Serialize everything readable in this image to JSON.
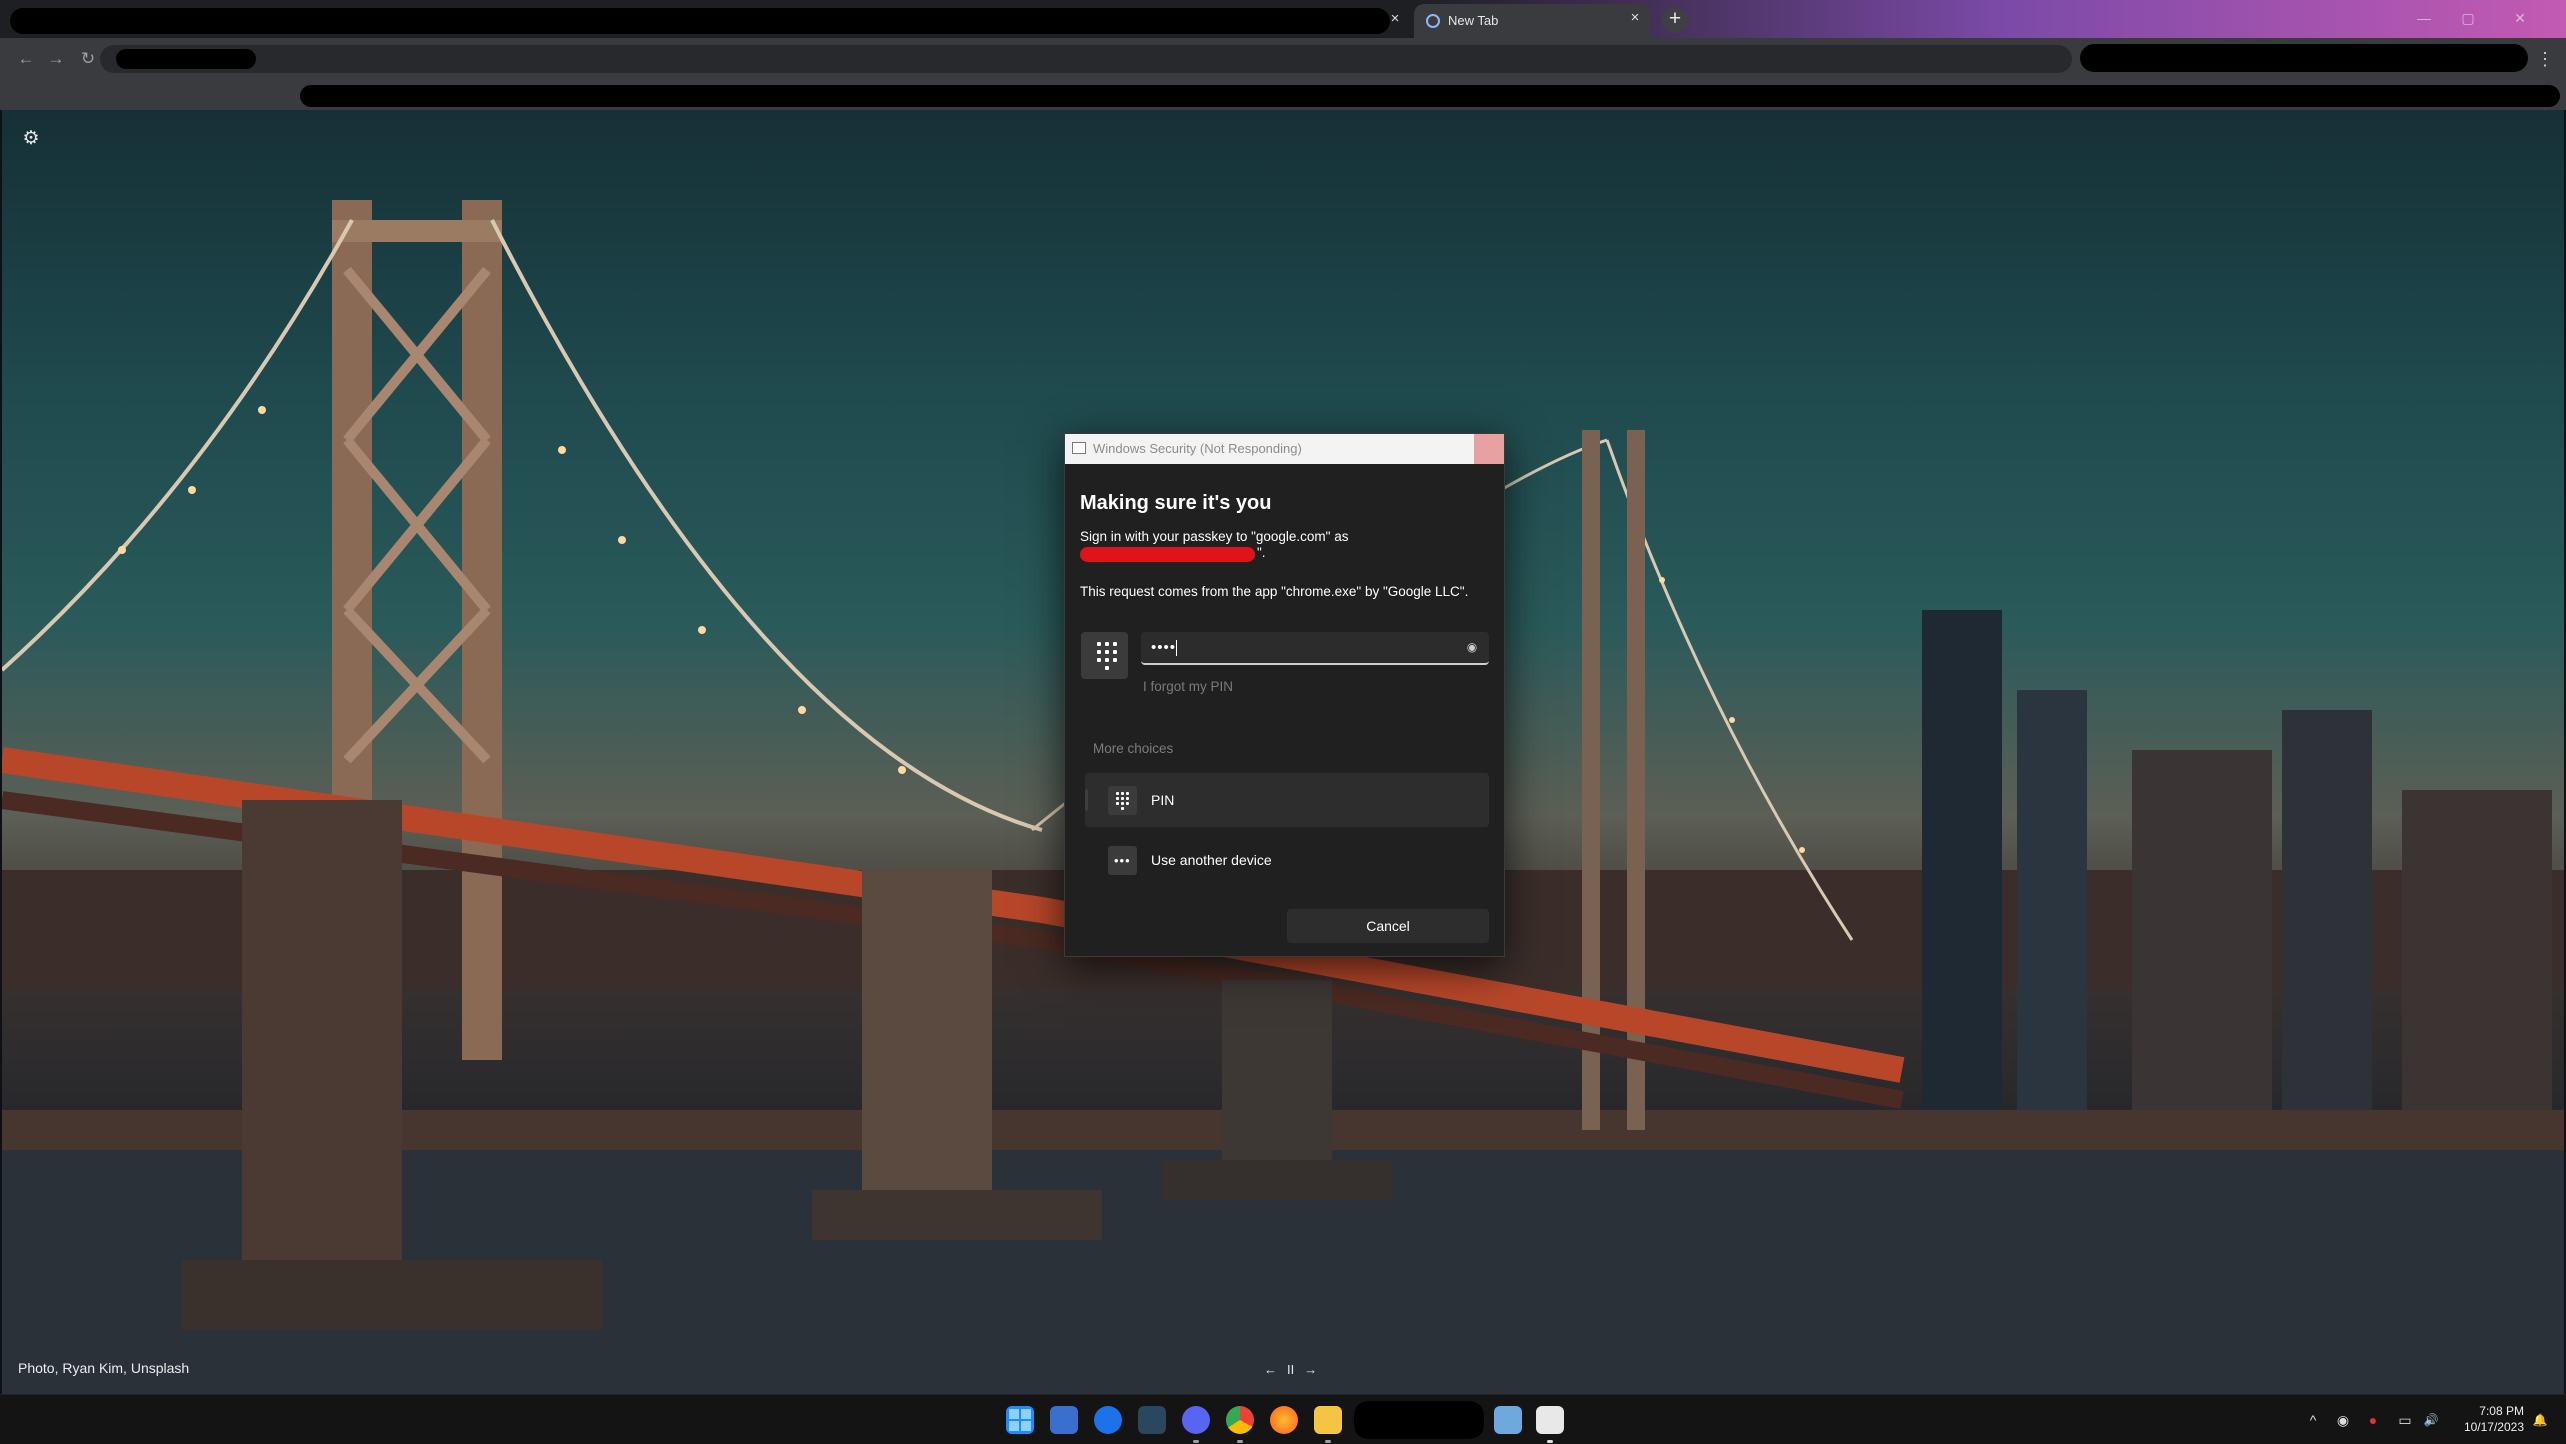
{
  "browser": {
    "tab_title": "New Tab",
    "tab_close": "×",
    "new_tab": "+",
    "menu": "⋮",
    "back": "←",
    "forward": "→",
    "reload": "↻",
    "minimize": "—",
    "maximize": "▢",
    "close": "✕"
  },
  "new_tab_page": {
    "settings_icon": "gear-icon",
    "settings_glyph": "⚙",
    "photo_credit": "Photo, Ryan Kim, Unsplash",
    "carousel_prev": "←",
    "carousel_pause": "II",
    "carousel_next": "→"
  },
  "dialog": {
    "window_title": "Windows Security (Not Responding)",
    "heading": "Making sure it's you",
    "sign_in_text": "Sign in with your passkey to \"google.com\" as",
    "redacted_tail": "\".",
    "request_text": "This request comes from the app \"chrome.exe\" by \"Google LLC\".",
    "pin_value": "••••",
    "reveal_glyph": "◉",
    "forgot_pin": "I forgot my PIN",
    "more_choices": "More choices",
    "choices": [
      {
        "label": "PIN",
        "icon": "keypad-icon",
        "selected": true
      },
      {
        "label": "Use another device",
        "icon": "more-dots-icon",
        "selected": false
      }
    ],
    "more_dots": "•••",
    "cancel": "Cancel"
  },
  "taskbar": {
    "time": "7:08 PM",
    "date": "10/17/2023",
    "tray_chevron": "^",
    "tray_volume": "🔊",
    "tray_network": "▭",
    "tray_bell": "🔔",
    "tray_circle1": "◉",
    "tray_circle2": "●"
  },
  "colors": {
    "dialog_bg": "#202020",
    "redaction": "#e0121a",
    "taskbar_bg": "#141414",
    "tab_strip_gradient_end": "#c35ab3"
  }
}
